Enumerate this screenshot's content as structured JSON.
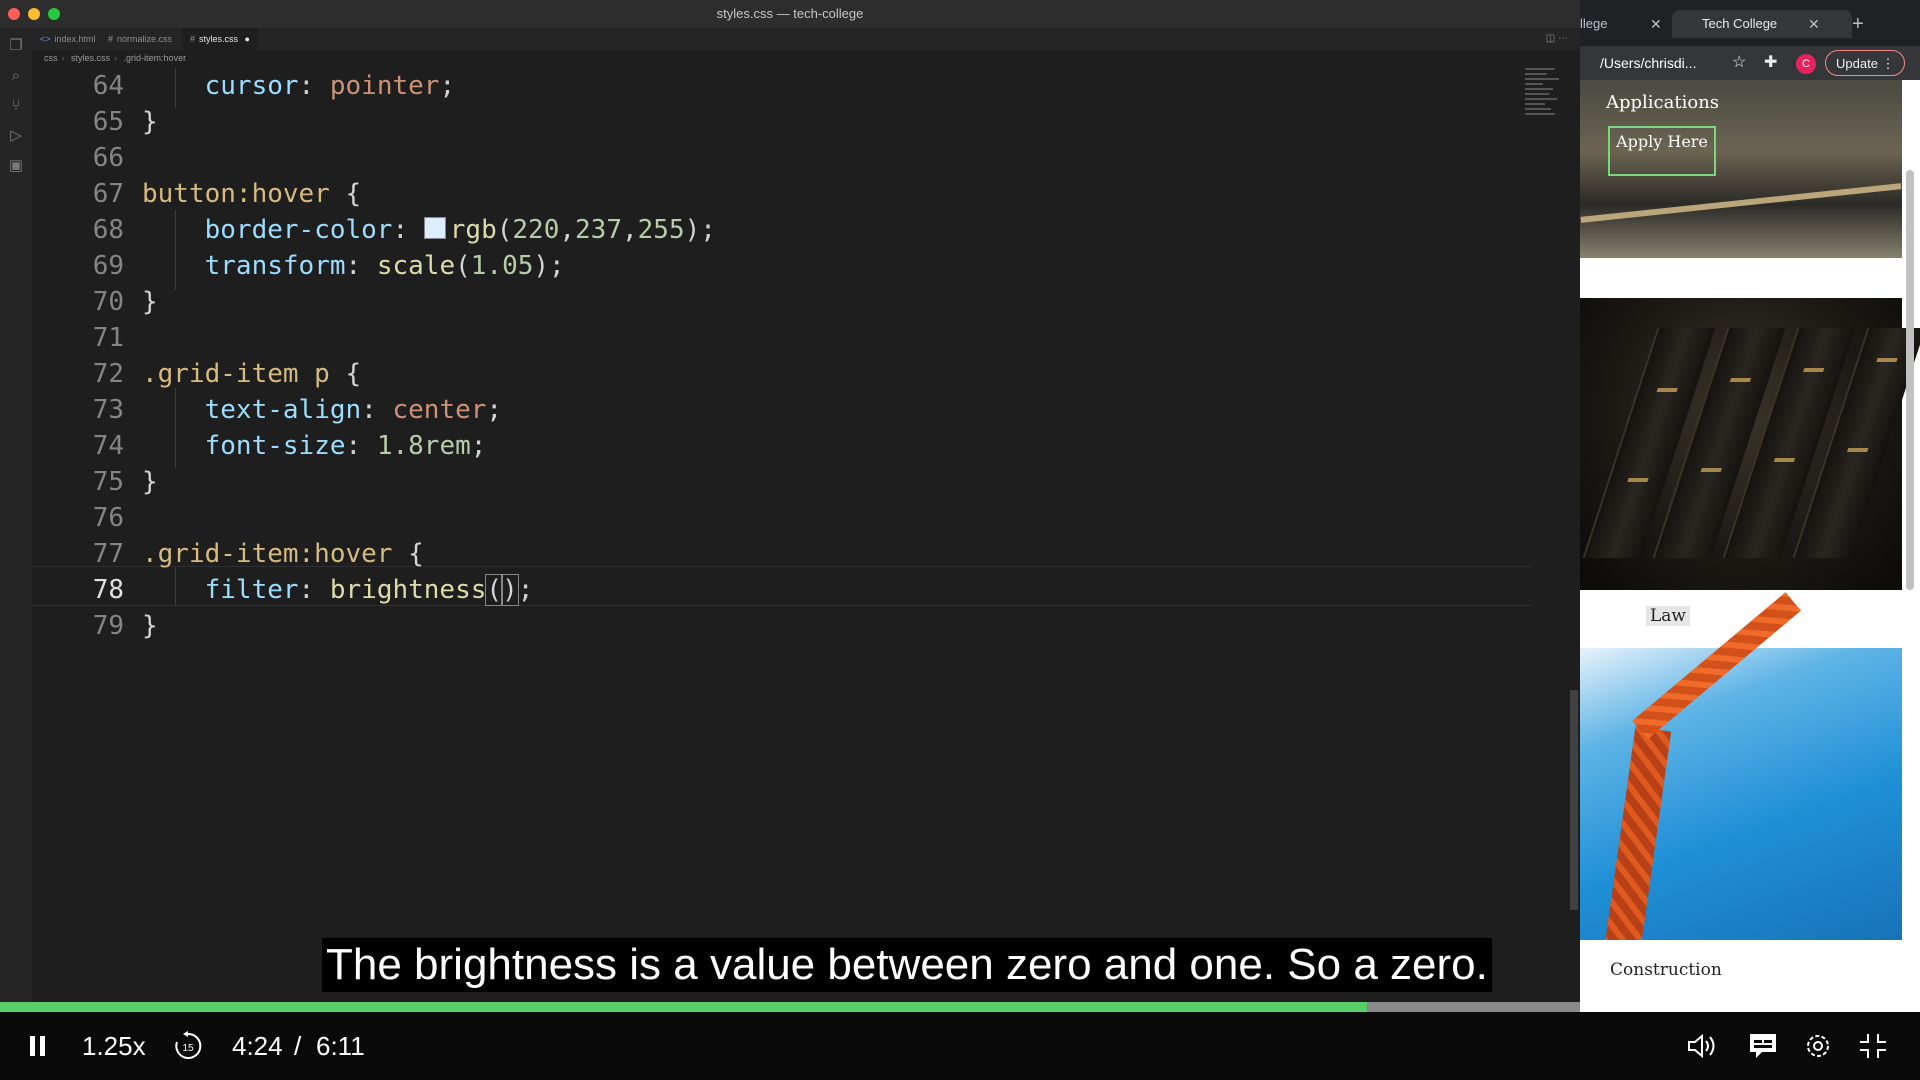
{
  "editor": {
    "window_title": "styles.css — tech-college",
    "tabs": [
      {
        "label": "index.html",
        "glyph": "<>"
      },
      {
        "label": "normalize.css",
        "glyph": "#"
      },
      {
        "label": "styles.css",
        "glyph": "#",
        "modified": "●"
      }
    ],
    "breadcrumb": [
      "css",
      "styles.css",
      ".grid-item:hover"
    ],
    "code_lines": [
      {
        "n": "64",
        "text": "    cursor: pointer;"
      },
      {
        "n": "65",
        "text": "}"
      },
      {
        "n": "66",
        "text": ""
      },
      {
        "n": "67",
        "text": "button:hover {"
      },
      {
        "n": "68",
        "text": "    border-color: rgb(220,237,255);"
      },
      {
        "n": "69",
        "text": "    transform: scale(1.05);"
      },
      {
        "n": "70",
        "text": "}"
      },
      {
        "n": "71",
        "text": ""
      },
      {
        "n": "72",
        "text": ".grid-item p {"
      },
      {
        "n": "73",
        "text": "    text-align: center;"
      },
      {
        "n": "74",
        "text": "    font-size: 1.8rem;"
      },
      {
        "n": "75",
        "text": "}"
      },
      {
        "n": "76",
        "text": ""
      },
      {
        "n": "77",
        "text": ".grid-item:hover {"
      },
      {
        "n": "78",
        "text": "    filter: brightness();"
      },
      {
        "n": "79",
        "text": "}"
      }
    ],
    "current_line": "78",
    "color_swatch": "#dcedff"
  },
  "browser": {
    "tab_partial": "llege",
    "tab_active": "Tech College",
    "url": "/Users/chrisdi...",
    "avatar_letter": "C",
    "update_label": "Update",
    "hero_title": "Applications",
    "hero_button": "Apply Here",
    "law_caption": "Law",
    "construction_caption": "Construction"
  },
  "video": {
    "subtitle": "The brightness is a value between zero and one. So a zero.",
    "speed": "1.25x",
    "skip_back": "15",
    "current_time": "4:24",
    "time_separator": "/",
    "total_time": "6:11",
    "progress_fraction": 0.712,
    "buffer_fraction": 0.913,
    "progress_color": "#57d06a"
  },
  "icons": {
    "play_pause": "pause-icon",
    "rewind": "rewind-15-icon",
    "volume": "volume-icon",
    "captions": "captions-icon",
    "settings": "gear-icon",
    "exit_fullscreen": "exit-fullscreen-icon"
  }
}
